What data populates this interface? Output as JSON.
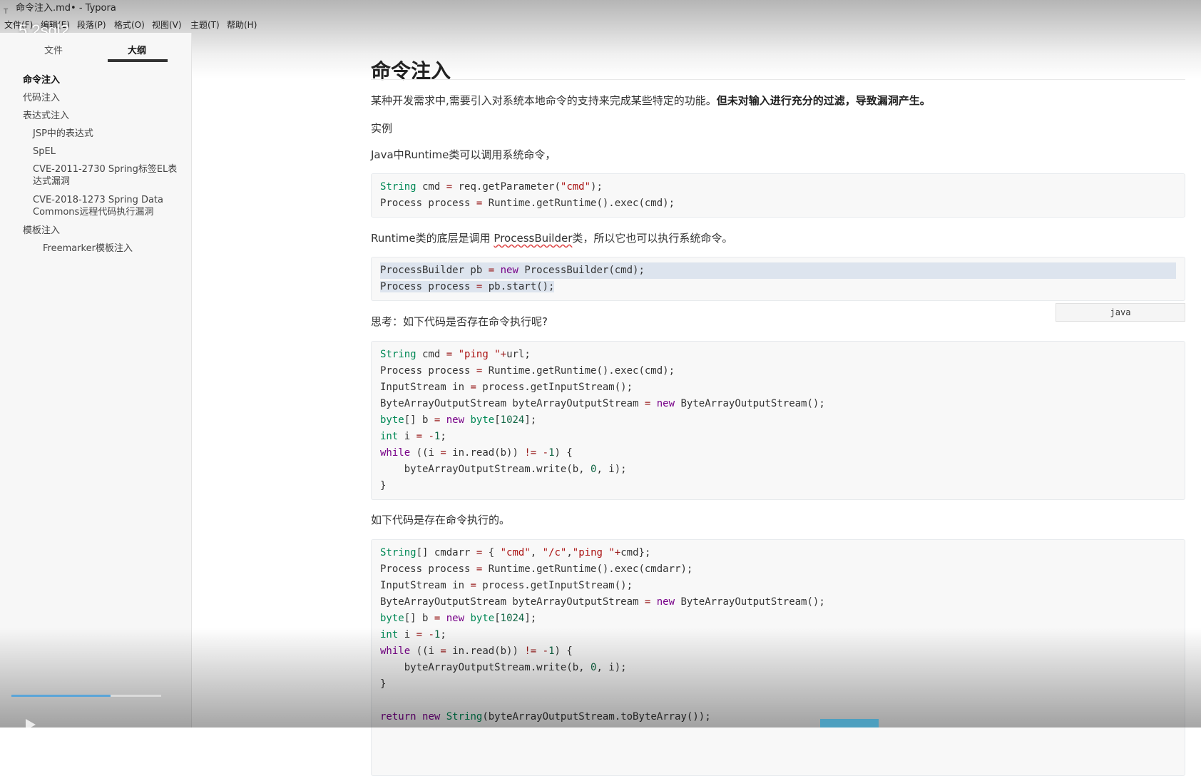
{
  "window": {
    "title": "命令注入.md• - Typora"
  },
  "menu": [
    "文件(F)",
    "编辑(E)",
    "段落(P)",
    "格式(O)",
    "视图(V)",
    "主题(T)",
    "帮助(H)"
  ],
  "overlay_title": "5.2sql2",
  "sidebar": {
    "tabs": [
      {
        "label": "文件",
        "active": false
      },
      {
        "label": "大纲",
        "active": true
      }
    ],
    "outline": [
      {
        "label": "命令注入",
        "level": 1,
        "active": true
      },
      {
        "label": "代码注入",
        "level": 1
      },
      {
        "label": "表达式注入",
        "level": 1
      },
      {
        "label": "JSP中的表达式",
        "level": 2
      },
      {
        "label": "SpEL",
        "level": 2
      },
      {
        "label": "CVE-2011-2730 Spring标签EL表\n达式漏洞",
        "level": 2
      },
      {
        "label": "CVE-2018-1273 Spring Data\nCommons远程代码执行漏洞",
        "level": 2
      },
      {
        "label": "模板注入",
        "level": 1
      },
      {
        "label": "Freemarker模板注入",
        "level": 3
      }
    ]
  },
  "doc": {
    "heading": "命令注入",
    "intro_normal": "某种开发需求中,需要引入对系统本地命令的支持来完成某些特定的功能。",
    "intro_bold": "但未对输入进行充分的过滤，导致漏洞产生。",
    "example": "实例",
    "java_runtime": "Java中Runtime类可以调用系统命令，",
    "pb_prefix": "Runtime类的底层是调用 ",
    "pb_link": "ProcessBuilder",
    "pb_suffix": "类，所以它也可以执行系统命令。",
    "think": "思考：如下代码是否存在命令执行呢?",
    "exists": "如下代码是存在命令执行的。",
    "lang_label": "java"
  },
  "code1": [
    "String cmd = req.getParameter(\"cmd\");",
    "Process process = Runtime.getRuntime().exec(cmd);"
  ],
  "code2": [
    "ProcessBuilder pb = new ProcessBuilder(cmd);",
    "Process process = pb.start();"
  ],
  "code3": [
    "String cmd = \"ping \"+url;",
    "Process process = Runtime.getRuntime().exec(cmd);",
    "InputStream in = process.getInputStream();",
    "ByteArrayOutputStream byteArrayOutputStream = new ByteArrayOutputStream();",
    "byte[] b = new byte[1024];",
    "int i = -1;",
    "while ((i = in.read(b)) != -1) {",
    "    byteArrayOutputStream.write(b, 0, i);",
    "}"
  ],
  "code4": [
    "String[] cmdarr = { \"cmd\", \"/c\",\"ping \"+cmd};",
    "Process process = Runtime.getRuntime().exec(cmdarr);",
    "InputStream in = process.getInputStream();",
    "ByteArrayOutputStream byteArrayOutputStream = new ByteArrayOutputStream();",
    "byte[] b = new byte[1024];",
    "int i = -1;",
    "while ((i = in.read(b)) != -1) {",
    "    byteArrayOutputStream.write(b, 0, i);",
    "}",
    "",
    "return new String(byteArrayOutputStream.toByteArray());"
  ],
  "player": {
    "progress": 0.66
  }
}
